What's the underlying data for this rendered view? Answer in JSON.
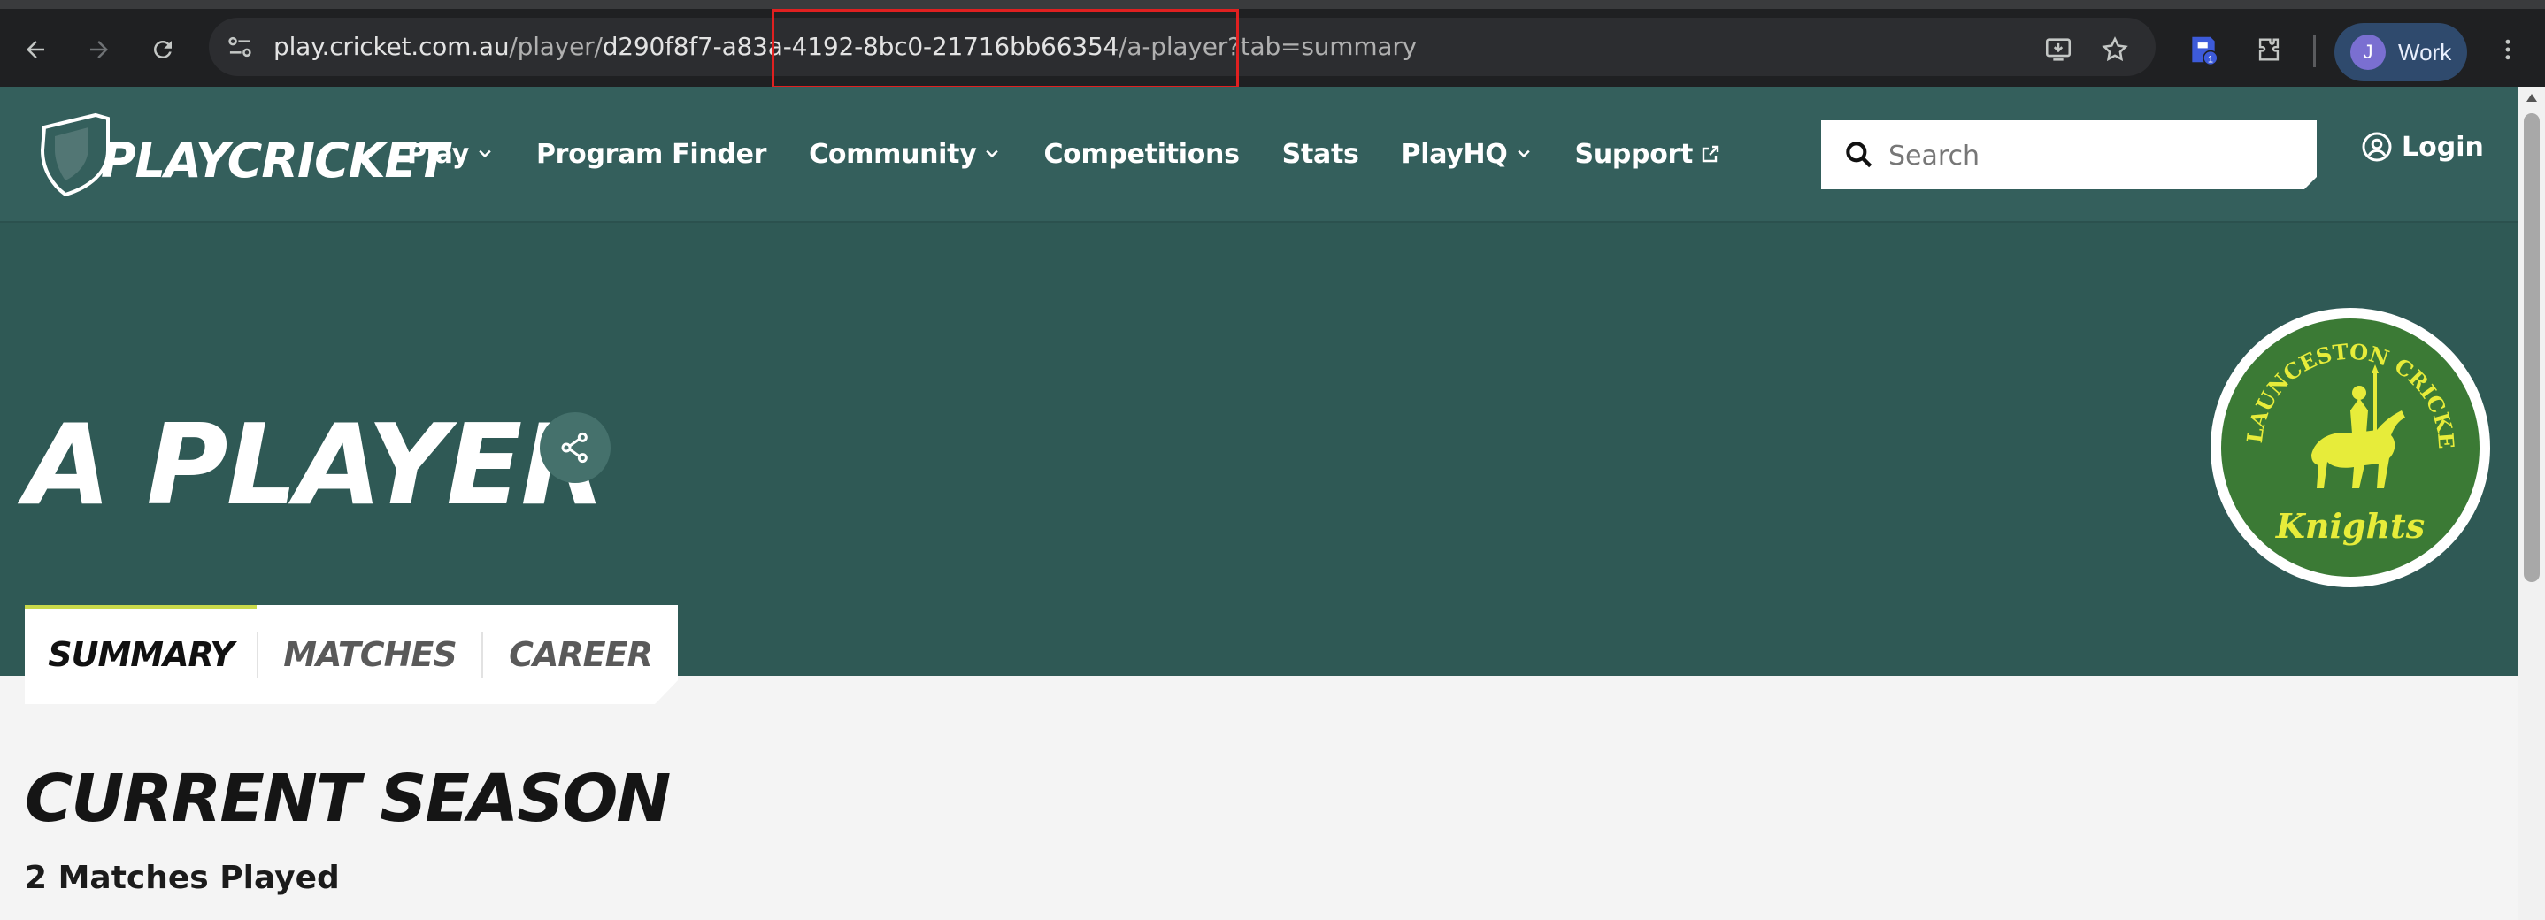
{
  "browser": {
    "url_domain": "play.cricket.com.au",
    "url_path_prefix": "/player/",
    "url_player_id": "d290f8f7-a83a-4192-8bc0-21716bb66354",
    "url_suffix": "/a-player?tab=summary",
    "profile_initial": "J",
    "profile_label": "Work",
    "extension_badge": "1"
  },
  "header": {
    "logo_text": "PLAYCRICKET",
    "nav": [
      {
        "label": "Play",
        "has_dropdown": true
      },
      {
        "label": "Program Finder",
        "has_dropdown": false
      },
      {
        "label": "Community",
        "has_dropdown": true
      },
      {
        "label": "Competitions",
        "has_dropdown": false
      },
      {
        "label": "Stats",
        "has_dropdown": false
      },
      {
        "label": "PlayHQ",
        "has_dropdown": true
      },
      {
        "label": "Support",
        "has_dropdown": false,
        "external": true
      }
    ],
    "search_placeholder": "Search",
    "login_label": "Login"
  },
  "hero": {
    "player_name": "A PLAYER",
    "club_badge_top_text": "SOUTH LAUNCESTON CRICKET CLUB",
    "club_badge_bottom_text": "Knights"
  },
  "tabs": [
    {
      "label": "SUMMARY",
      "active": true
    },
    {
      "label": "MATCHES",
      "active": false
    },
    {
      "label": "CAREER",
      "active": false
    }
  ],
  "content": {
    "section_title": "CURRENT SEASON",
    "matches_played": "2 Matches Played"
  },
  "colors": {
    "header_bg": "#345f5c",
    "hero_bg": "#2f5955",
    "tab_accent": "#c9d94a",
    "badge_green": "#3b7a35",
    "badge_yellow": "#e7ec3a"
  }
}
